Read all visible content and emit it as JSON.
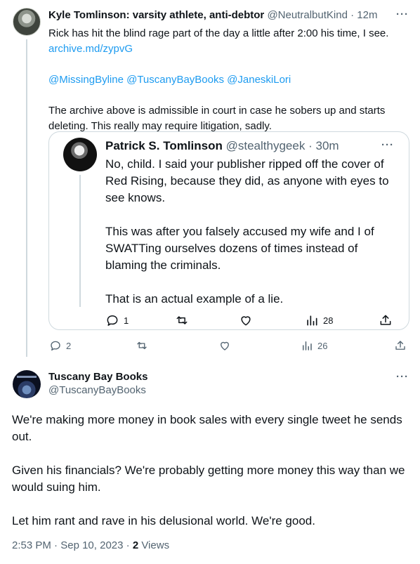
{
  "tweet1": {
    "author_name": "Kyle Tomlinson: varsity athlete, anti-debtor",
    "handle": "@NeutralbutKind",
    "separator": "·",
    "time": "12m",
    "more": "···",
    "line1": "Rick has hit the blind rage part of the day a little after 2:00 his time, I see.",
    "link": "archive.md/zypvG",
    "mentions": "@MissingByline @TuscanyBayBooks @JaneskiLori",
    "line2": "The archive above is admissible in court in case he sobers up and starts deleting. This really may require litigation, sadly.",
    "stats": {
      "replies": "2",
      "views": "26"
    }
  },
  "quote": {
    "author_name": "Patrick S. Tomlinson",
    "handle": "@stealthygeek",
    "separator": "·",
    "time": "30m",
    "more": "···",
    "para1": "No, child. I said your publisher ripped off the cover of Red Rising, because they did, as anyone with eyes to see knows.",
    "para2": "This was after you falsely accused my wife and I of SWATTing ourselves dozens of times instead of blaming the criminals.",
    "para3": "That is an actual example of a lie.",
    "stats": {
      "replies": "1",
      "views": "28"
    }
  },
  "tweet2": {
    "author_name": "Tuscany Bay Books",
    "handle": "@TuscanyBayBooks",
    "more": "···",
    "para1": "We're making more money in book sales with every single tweet he sends out.",
    "para2": "Given his financials? We're probably getting more money this way than we would suing him.",
    "para3": "Let him rant and rave in his delusional world. We're good.",
    "time": "2:53 PM",
    "separator": "·",
    "date": "Sep 10, 2023",
    "views_count": "2",
    "views_label": "Views"
  }
}
